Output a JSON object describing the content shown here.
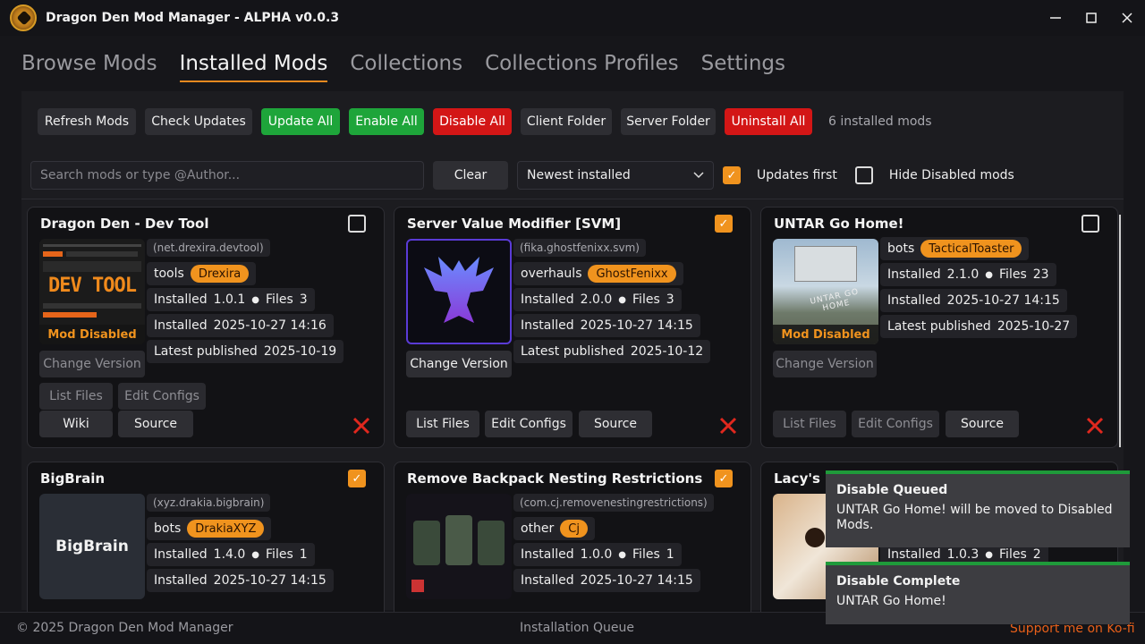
{
  "window": {
    "title": "Dragon Den Mod Manager - ALPHA v0.0.3"
  },
  "tabs": [
    "Browse Mods",
    "Installed Mods",
    "Collections",
    "Collections Profiles",
    "Settings"
  ],
  "active_tab": "Installed Mods",
  "toolbar": {
    "refresh": "Refresh Mods",
    "check_updates": "Check Updates",
    "update_all": "Update All",
    "enable_all": "Enable All",
    "disable_all": "Disable All",
    "client_folder": "Client Folder",
    "server_folder": "Server Folder",
    "uninstall_all": "Uninstall All",
    "count": "6 installed mods"
  },
  "filters": {
    "search_placeholder": "Search mods or type @Author...",
    "clear": "Clear",
    "sort": "Newest installed",
    "updates_first": "Updates first",
    "updates_first_checked": true,
    "hide_disabled": "Hide Disabled mods",
    "hide_disabled_checked": false
  },
  "labels": {
    "installed": "Installed",
    "files": "Files",
    "latest": "Latest published",
    "mod_disabled": "Mod Disabled",
    "change_version": "Change Version",
    "list_files": "List Files",
    "edit_configs": "Edit Configs",
    "wiki": "Wiki",
    "source": "Source"
  },
  "mods": [
    {
      "title": "Dragon Den - Dev Tool",
      "pkg": "(net.drexira.devtool)",
      "category": "tools",
      "author": "Drexira",
      "version": "1.0.1",
      "files": "3",
      "installed_at": "2025-10-27 14:16",
      "latest": "2025-10-19",
      "enabled": false,
      "thumb_text": "DEV TOOL"
    },
    {
      "title": "Server Value Modifier [SVM]",
      "pkg": "(fika.ghostfenixx.svm)",
      "category": "overhauls",
      "author": "GhostFenixx",
      "version": "2.0.0",
      "files": "3",
      "installed_at": "2025-10-27 14:15",
      "latest": "2025-10-12",
      "enabled": true
    },
    {
      "title": "UNTAR Go Home!",
      "category": "bots",
      "author": "TacticalToaster",
      "version": "2.1.0",
      "files": "23",
      "installed_at": "2025-10-27 14:15",
      "latest": "2025-10-27",
      "enabled": false,
      "thumb_text": "UNTAR GO HOME"
    },
    {
      "title": "BigBrain",
      "pkg": "(xyz.drakia.bigbrain)",
      "category": "bots",
      "author": "DrakiaXYZ",
      "version": "1.4.0",
      "files": "1",
      "installed_at": "2025-10-27 14:15",
      "enabled": true,
      "thumb_text": "BigBrain"
    },
    {
      "title": "Remove Backpack Nesting Restrictions",
      "pkg": "(com.cj.removenestingrestrictions)",
      "category": "other",
      "author": "Cj",
      "version": "1.0.0",
      "files": "1",
      "installed_at": "2025-10-27 14:15",
      "enabled": true
    },
    {
      "title": "Lacy's R",
      "version": "1.0.3",
      "files": "2",
      "enabled": true
    }
  ],
  "toasts": [
    {
      "title": "Disable Queued",
      "message": "UNTAR Go Home! will be moved to Disabled Mods."
    },
    {
      "title": "Disable Complete",
      "message": "UNTAR Go Home!"
    }
  ],
  "footer": {
    "copyright": "© 2025 Dragon Den Mod Manager",
    "queue": "Installation Queue",
    "support": "Support me on Ko-fi"
  },
  "colors": {
    "accent": "#f0931e",
    "green": "#1ea53a",
    "red": "#d31616",
    "delete_x": "#e0281e"
  }
}
